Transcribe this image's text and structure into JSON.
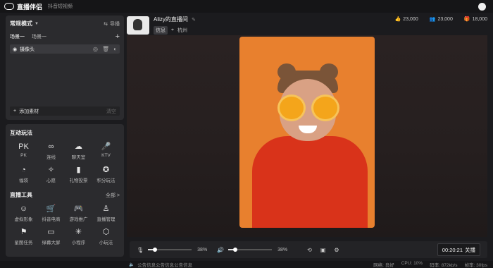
{
  "app": {
    "name": "直播伴侣",
    "subtitle": "抖音短视频"
  },
  "scene_panel": {
    "mode": "常规模式",
    "guide_label": "导播",
    "tabs": [
      "场景一",
      "场景一"
    ],
    "source_item": "摄像头",
    "add_material": "添加素材",
    "clear_label": "清空"
  },
  "interact": {
    "title": "互动玩法",
    "items": [
      {
        "icon": "PK",
        "label": "PK"
      },
      {
        "icon": "∞",
        "label": "连线"
      },
      {
        "icon": "☁",
        "label": "聊天室"
      },
      {
        "icon": "🎤",
        "label": "KTV"
      },
      {
        "icon": "◔",
        "label": "福袋"
      },
      {
        "icon": "✧",
        "label": "心愿"
      },
      {
        "icon": "▮",
        "label": "礼物投票"
      },
      {
        "icon": "✪",
        "label": "积分玩法"
      }
    ]
  },
  "live_tools": {
    "title": "直播工具",
    "all_label": "全部 >",
    "items": [
      {
        "icon": "☺",
        "label": "虚拟形象"
      },
      {
        "icon": "🛒",
        "label": "抖音电商"
      },
      {
        "icon": "🎮",
        "label": "游戏推广"
      },
      {
        "icon": "♙",
        "label": "直播管理"
      },
      {
        "icon": "⚑",
        "label": "星图任务"
      },
      {
        "icon": "▭",
        "label": "绿幕大屏"
      },
      {
        "icon": "✳",
        "label": "小程序"
      },
      {
        "icon": "⬡",
        "label": "小玩法"
      }
    ]
  },
  "profile": {
    "name": "Alizy的直播间",
    "badge": "信息",
    "location": "杭州"
  },
  "stats": {
    "likes": "23,000",
    "viewers": "23,000",
    "gifts": "18,000"
  },
  "controls": {
    "mic_level": 0.16,
    "mic_percent": "38%",
    "speaker_level": 0.16,
    "speaker_percent": "38%",
    "timer": "00:20:21",
    "end_label": "关播"
  },
  "status": {
    "notice": "公告信息公告信息公告信息",
    "network": "网络: 良好",
    "cpu": "CPU: 10%",
    "bitrate": "码率: 872kb/s",
    "fps": "帧率: 30fps"
  }
}
